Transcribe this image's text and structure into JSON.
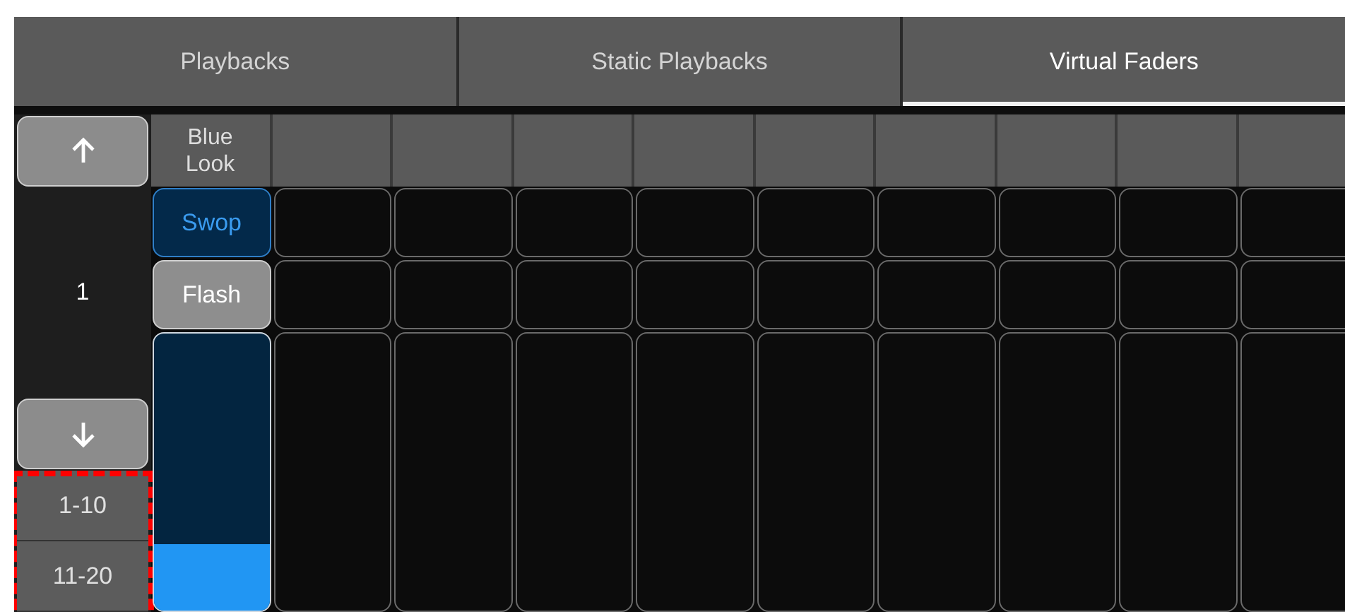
{
  "tabs": [
    {
      "label": "Playbacks",
      "selected": false
    },
    {
      "label": "Static Playbacks",
      "selected": false
    },
    {
      "label": "Virtual Faders",
      "selected": true
    }
  ],
  "pager": {
    "page": "1",
    "banks": [
      {
        "label": "1-10"
      },
      {
        "label": "11-20"
      }
    ],
    "banks_highlighted": true
  },
  "faders": [
    {
      "name": "Blue Look",
      "assigned": true,
      "buttons": [
        {
          "label": "Swop",
          "kind": "swop"
        },
        {
          "label": "Flash",
          "kind": "flash"
        }
      ],
      "level": 0.24
    },
    {
      "assigned": false
    },
    {
      "assigned": false
    },
    {
      "assigned": false
    },
    {
      "assigned": false
    },
    {
      "assigned": false
    },
    {
      "assigned": false
    },
    {
      "assigned": false
    },
    {
      "assigned": false
    },
    {
      "assigned": false
    }
  ]
}
